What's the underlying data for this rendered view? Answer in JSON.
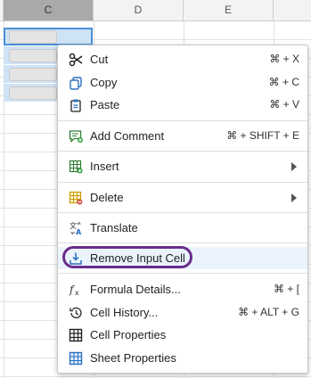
{
  "columns": {
    "c": "C",
    "d": "D",
    "e": "E"
  },
  "menu": {
    "cut": {
      "label": "Cut",
      "shortcut": "⌘ + X"
    },
    "copy": {
      "label": "Copy",
      "shortcut": "⌘ + C"
    },
    "paste": {
      "label": "Paste",
      "shortcut": "⌘ + V"
    },
    "add_comment": {
      "label": "Add Comment",
      "shortcut": "⌘ + SHIFT + E"
    },
    "insert": {
      "label": "Insert"
    },
    "delete": {
      "label": "Delete"
    },
    "translate": {
      "label": "Translate"
    },
    "remove_input": {
      "label": "Remove Input Cell"
    },
    "formula": {
      "label": "Formula Details...",
      "shortcut": "⌘ + ["
    },
    "history": {
      "label": "Cell History...",
      "shortcut": "⌘ + ALT + G"
    },
    "cell_props": {
      "label": "Cell Properties"
    },
    "sheet_props": {
      "label": "Sheet Properties"
    }
  },
  "colors": {
    "accent": "#4a90d9",
    "highlight_ring": "#6a2c8c",
    "selection": "#cfe3f7"
  }
}
